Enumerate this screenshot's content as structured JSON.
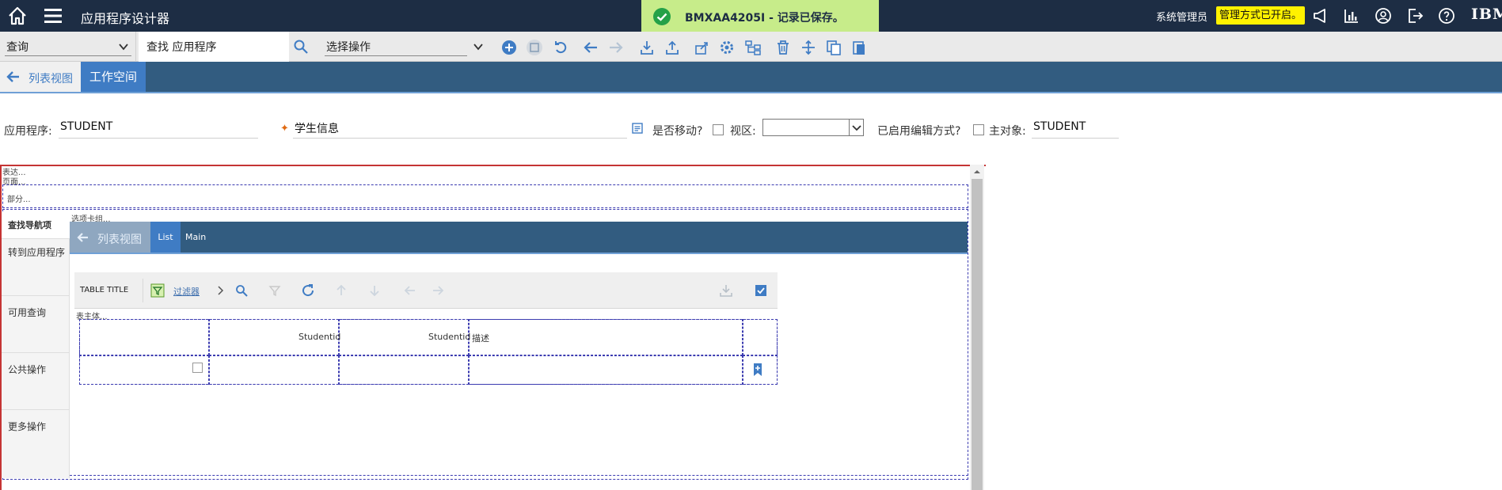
{
  "topbar": {
    "app_title": "应用程序设计器",
    "user": "系统管理员",
    "admin_mode": "管理方式已开启。",
    "brand": "IBM",
    "icons": [
      "home-icon",
      "menu-icon",
      "megaphone-icon",
      "chart-icon",
      "user-icon",
      "logout-icon",
      "help-icon"
    ]
  },
  "toast": {
    "message": "BMXAA4205I - 记录已保存。"
  },
  "toolbar": {
    "query_value": "查询",
    "search_value": "查找 应用程序",
    "action_value": "选择操作"
  },
  "nav": {
    "back_label": "列表视图",
    "workspace_tab": "工作空间"
  },
  "form": {
    "app_label": "应用程序:",
    "app_value": "STUDENT",
    "desc_value": "学生信息",
    "mobile_label": "是否移动?",
    "view_label": "视区:",
    "editable_label": "已启用编辑方式?",
    "main_object_label": "主对象:",
    "main_object_value": "STUDENT"
  },
  "designer": {
    "marker_presentation": "表达...",
    "marker_page": "页面...",
    "marker_section": "部分...",
    "marker_tabgroup": "选项卡组...",
    "marker_tablebody": "表主体...",
    "sidebar": [
      "查找导航项",
      "转到应用程序",
      "可用查询",
      "公共操作",
      "更多操作"
    ],
    "inner_back": "列表视图",
    "inner_tab_list": "List",
    "inner_tab_main": "Main",
    "table_title": "TABLE TITLE",
    "filter_label": "过滤器",
    "columns": [
      "",
      "Studentid",
      "Studentid",
      "描述",
      ""
    ]
  }
}
